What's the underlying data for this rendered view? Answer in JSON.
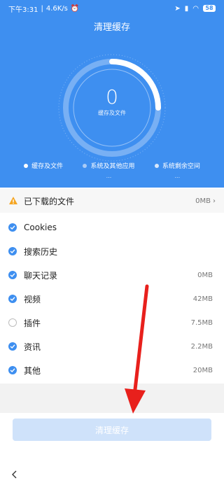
{
  "status": {
    "time": "下午3:31",
    "speed": "4.6K/s",
    "battery": "58"
  },
  "header": {
    "title": "清理缓存",
    "ring_value": "0",
    "ring_label": "缓存及文件",
    "progress_fraction": 0.25
  },
  "legend": [
    {
      "label": "缓存及文件",
      "value": "",
      "color": "#ffffff"
    },
    {
      "label": "系统及其他应用",
      "value": "...",
      "color": "#a9cbf6"
    },
    {
      "label": "系统剩余空间",
      "value": "...",
      "color": "#d7e7fb"
    }
  ],
  "downloaded": {
    "label": "已下载的文件",
    "size": "0MB"
  },
  "items": [
    {
      "label": "Cookies",
      "size": "",
      "checked": true
    },
    {
      "label": "搜索历史",
      "size": "",
      "checked": true
    },
    {
      "label": "聊天记录",
      "size": "0MB",
      "checked": true
    },
    {
      "label": "视频",
      "size": "42MB",
      "checked": true
    },
    {
      "label": "插件",
      "size": "7.5MB",
      "checked": false
    },
    {
      "label": "资讯",
      "size": "2.2MB",
      "checked": true
    },
    {
      "label": "其他",
      "size": "20MB",
      "checked": true
    }
  ],
  "button": {
    "label": "清理缓存"
  },
  "colors": {
    "accent": "#3e8ff0",
    "annotation": "#e8201c"
  }
}
